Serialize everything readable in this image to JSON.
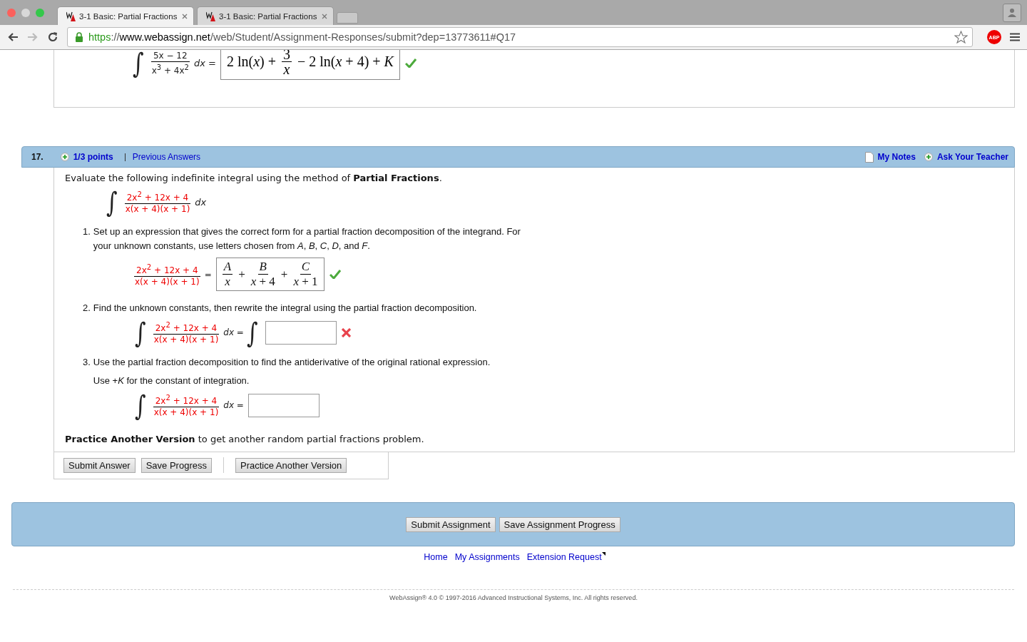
{
  "browser": {
    "tabs": [
      {
        "title": "3-1 Basic: Partial Fractions",
        "selected": true
      },
      {
        "title": "3-1 Basic: Partial Fractions",
        "selected": false
      }
    ],
    "url": {
      "scheme": "https",
      "separator": "://",
      "host": "www.webassign.net",
      "path": "/web/Student/Assignment-Responses/submit?dep=13773611#Q17"
    },
    "adblock_label": "ABP"
  },
  "previous_question": {
    "integral": {
      "sign": "∫",
      "numerator": "5x − 12",
      "denominator": "x$^{3}$ + 4x$^{2}$",
      "suffix": "*dx* ="
    },
    "answer": {
      "kind": "expression",
      "terms": [
        {
          "kind": "op",
          "text": "2 ln(*x*) +"
        },
        {
          "kind": "fraction",
          "num": "3",
          "den": "*x*"
        },
        {
          "kind": "op",
          "text": "− 2 ln(*x* + 4) + *K*"
        }
      ]
    },
    "correct": true
  },
  "question": {
    "number": "17.",
    "points": "1/3 points",
    "previous_answers": "Previous Answers",
    "my_notes": "My Notes",
    "ask_teacher": "Ask Your Teacher",
    "intro": "Evaluate the following indefinite integral using the method of **Partial Fractions**.",
    "integral": {
      "sign": "∫",
      "numerator": "2x$^{2}$ + 12x + 4",
      "denominator": "x(x + 4)(x + 1)",
      "suffix": "*dx*"
    },
    "parts": [
      {
        "number": "1.",
        "text": "Set up an expression that gives the correct form for a partial fraction decomposition of the integrand. For your unknown constants, use letters chosen from *A*, *B*, *C*, *D*, and *F*.",
        "integral": {
          "numerator": "2x$^{2}$ + 12x + 4",
          "denominator": "x(x + 4)(x + 1)",
          "suffix": "="
        },
        "answer": {
          "kind": "expression",
          "terms": [
            {
              "kind": "fraction",
              "num": "*A*",
              "den": "*x*"
            },
            {
              "kind": "op",
              "text": "+"
            },
            {
              "kind": "fraction",
              "num": "*B*",
              "den": "*x* + 4"
            },
            {
              "kind": "op",
              "text": "+"
            },
            {
              "kind": "fraction",
              "num": "*C*",
              "den": "*x* + 1"
            }
          ]
        },
        "correct": true
      },
      {
        "number": "2.",
        "text": "Find the unknown constants, then rewrite the integral using the partial fraction decomposition.",
        "integral": {
          "sign": "∫",
          "numerator": "2x$^{2}$ + 12x + 4",
          "denominator": "x(x + 4)(x + 1)",
          "suffix": "*dx* ="
        },
        "answer": {
          "kind": "field",
          "sign": "∫"
        },
        "correct": false
      },
      {
        "number": "3.",
        "text": "Use the partial fraction decomposition to find the antiderivative of the original rational expression.",
        "note": "Use +*K* for the constant of integration.",
        "integral": {
          "sign": "∫",
          "numerator": "2x$^{2}$ + 12x + 4",
          "denominator": "x(x + 4)(x + 1)",
          "suffix": "*dx* ="
        },
        "answer": {
          "kind": "field"
        }
      }
    ],
    "practice_note": "**Practice Another Version** to get another random partial fractions problem.",
    "buttons": [
      {
        "label": "Submit Answer",
        "separated": false
      },
      {
        "label": "Save Progress",
        "separated": false
      },
      {
        "label": "Practice Another Version",
        "separated": true
      }
    ]
  },
  "assignment_buttons": [
    "Submit Assignment",
    "Save Assignment Progress"
  ],
  "footer_links": [
    {
      "label": "Home",
      "external": false
    },
    {
      "label": "My Assignments",
      "external": false
    },
    {
      "label": "Extension Request",
      "external": true
    }
  ],
  "copyright": "WebAssign® 4.0 © 1997-2016 Advanced Instructional Systems, Inc. All rights reserved."
}
